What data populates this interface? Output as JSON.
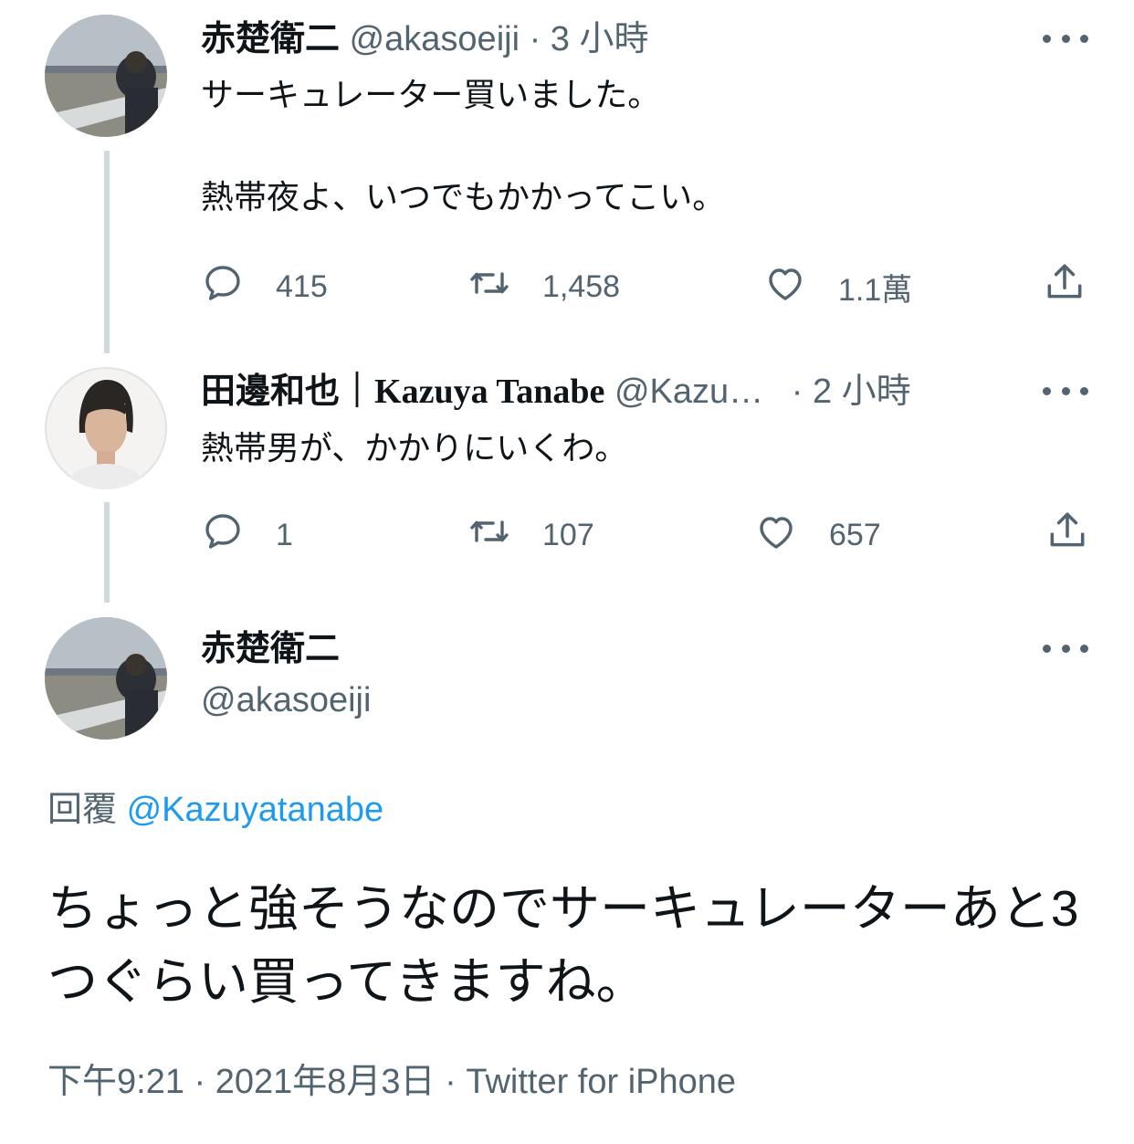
{
  "tweets": [
    {
      "name": "赤楚衛二",
      "handle": "@akasoeiji",
      "time": "3 小時",
      "text": "サーキュレーター買いました。\n\n熱帯夜よ、いつでもかかってこい。",
      "replies": "415",
      "retweets": "1,458",
      "likes": "1.1萬"
    },
    {
      "name_cjk": "田邊和也｜",
      "name_latin": "Kazuya Tanabe",
      "handle": "@Kazu…",
      "time": "2 小時",
      "text": "熱帯男が、かかりにいくわ。",
      "replies": "1",
      "retweets": "107",
      "likes": "657"
    }
  ],
  "main_tweet": {
    "name": "赤楚衛二",
    "handle": "@akasoeiji",
    "reply_label": "回覆",
    "reply_to": "@Kazuyatanabe",
    "text": "ちょっと強そうなのでサーキュレーターあと3つぐらい買ってきますね。",
    "timestamp": "下午9:21",
    "date": "2021年8月3日",
    "source": "Twitter for iPhone"
  },
  "separator": "·",
  "colors": {
    "text": "#0f1419",
    "muted": "#536471",
    "link": "#1d9bf0",
    "thread_line": "#cfd9de"
  },
  "icons": [
    "reply-icon",
    "retweet-icon",
    "like-icon",
    "share-icon",
    "more-icon"
  ]
}
